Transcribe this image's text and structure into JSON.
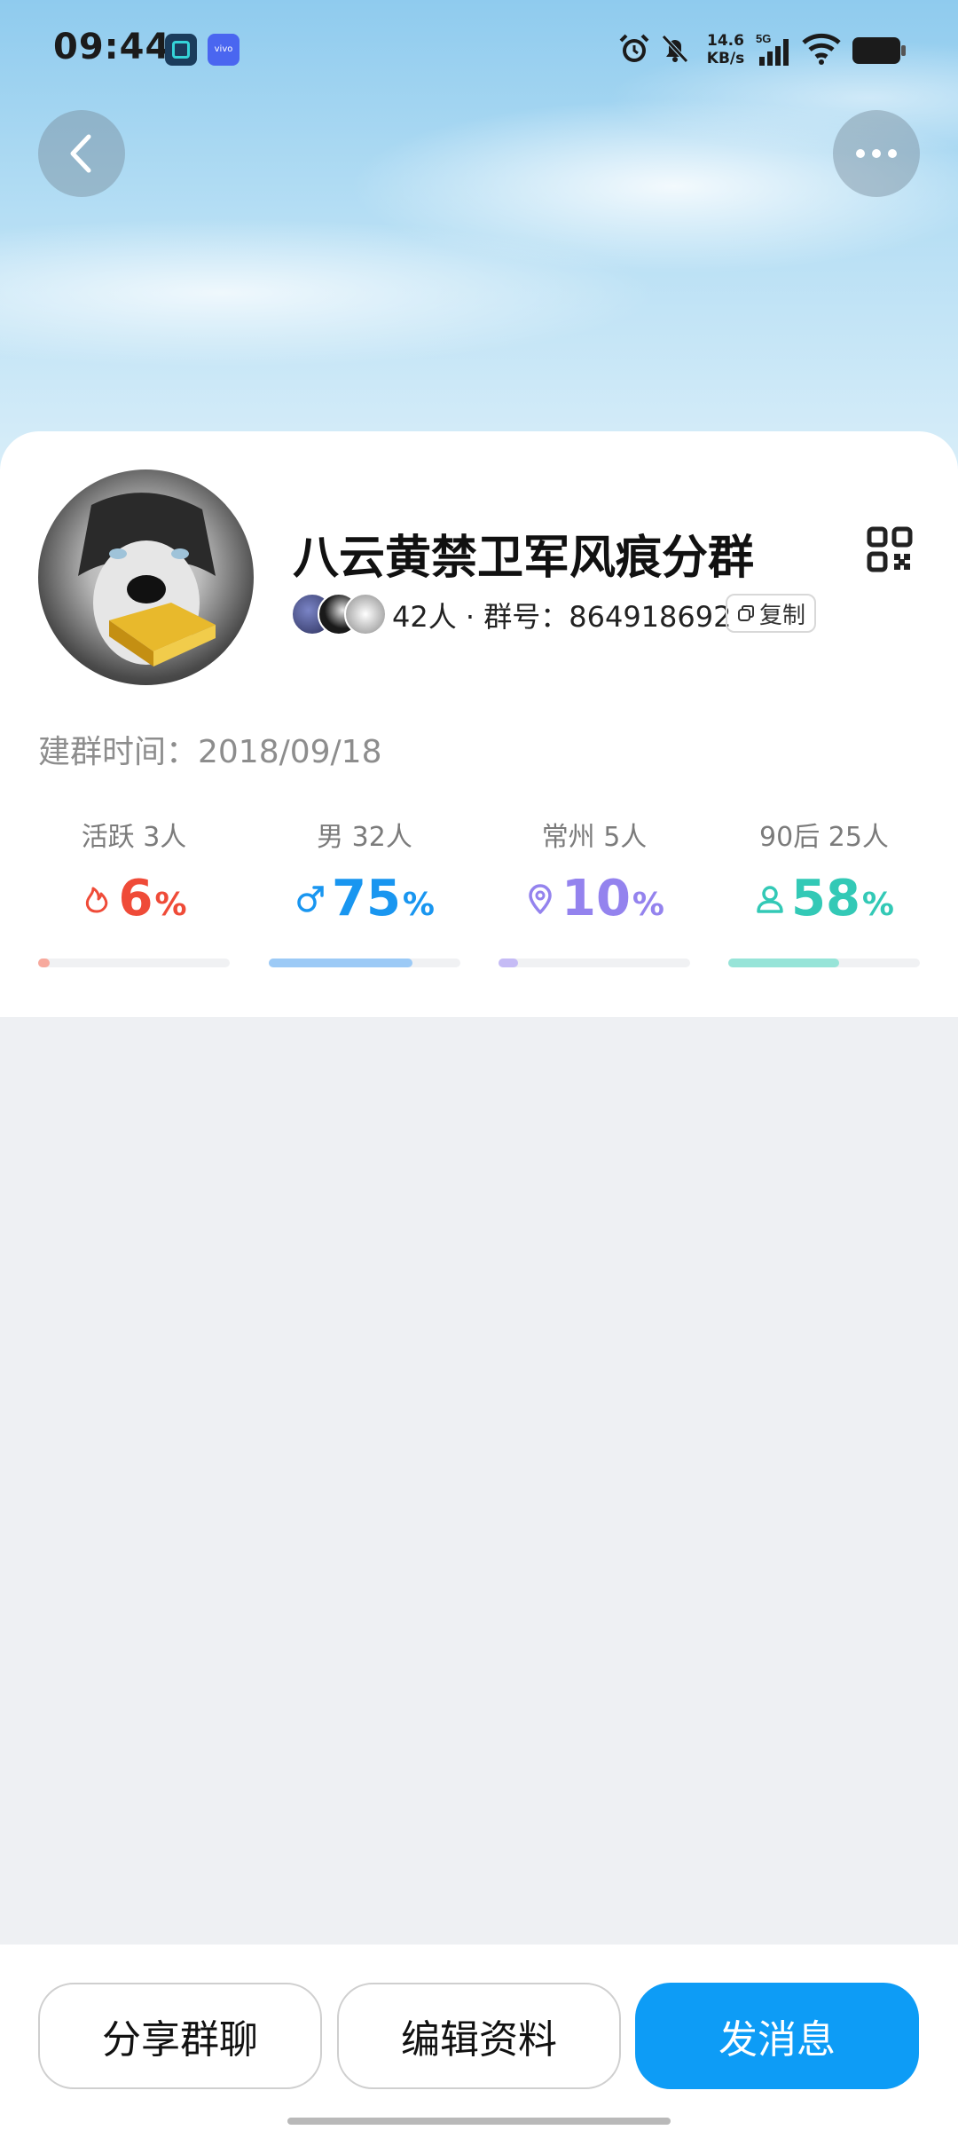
{
  "status_bar": {
    "time": "09:44",
    "app_badge_text": "vivo",
    "net_speed_value": "14.6",
    "net_speed_unit": "KB/s",
    "network_type": "5G"
  },
  "header": {
    "back_icon": "chevron-left-icon",
    "more_icon": "more-horizontal-icon"
  },
  "group": {
    "name": "八云黄禁卫军风痕分群",
    "member_info": "42人 · 群号：864918692",
    "copy_label": "复制",
    "create_time": "建群时间：2018/09/18"
  },
  "stats": [
    {
      "label": "活跃 3人",
      "value": "6",
      "unit": "%",
      "icon": "flame-icon",
      "color": "#ef4b38",
      "bar_color": "#f7a99d",
      "percent": 6
    },
    {
      "label": "男 32人",
      "value": "75",
      "unit": "%",
      "icon": "male-icon",
      "color": "#1996f0",
      "bar_color": "#9ccaf6",
      "percent": 75
    },
    {
      "label": "常州 5人",
      "value": "10",
      "unit": "%",
      "icon": "location-pin-icon",
      "color": "#9483ee",
      "bar_color": "#c5bbf5",
      "percent": 10
    },
    {
      "label": "90后 25人",
      "value": "58",
      "unit": "%",
      "icon": "person-icon",
      "color": "#33c9b6",
      "bar_color": "#97e4d8",
      "percent": 58
    }
  ],
  "actions": {
    "share": "分享群聊",
    "edit": "编辑资料",
    "send": "发消息"
  }
}
